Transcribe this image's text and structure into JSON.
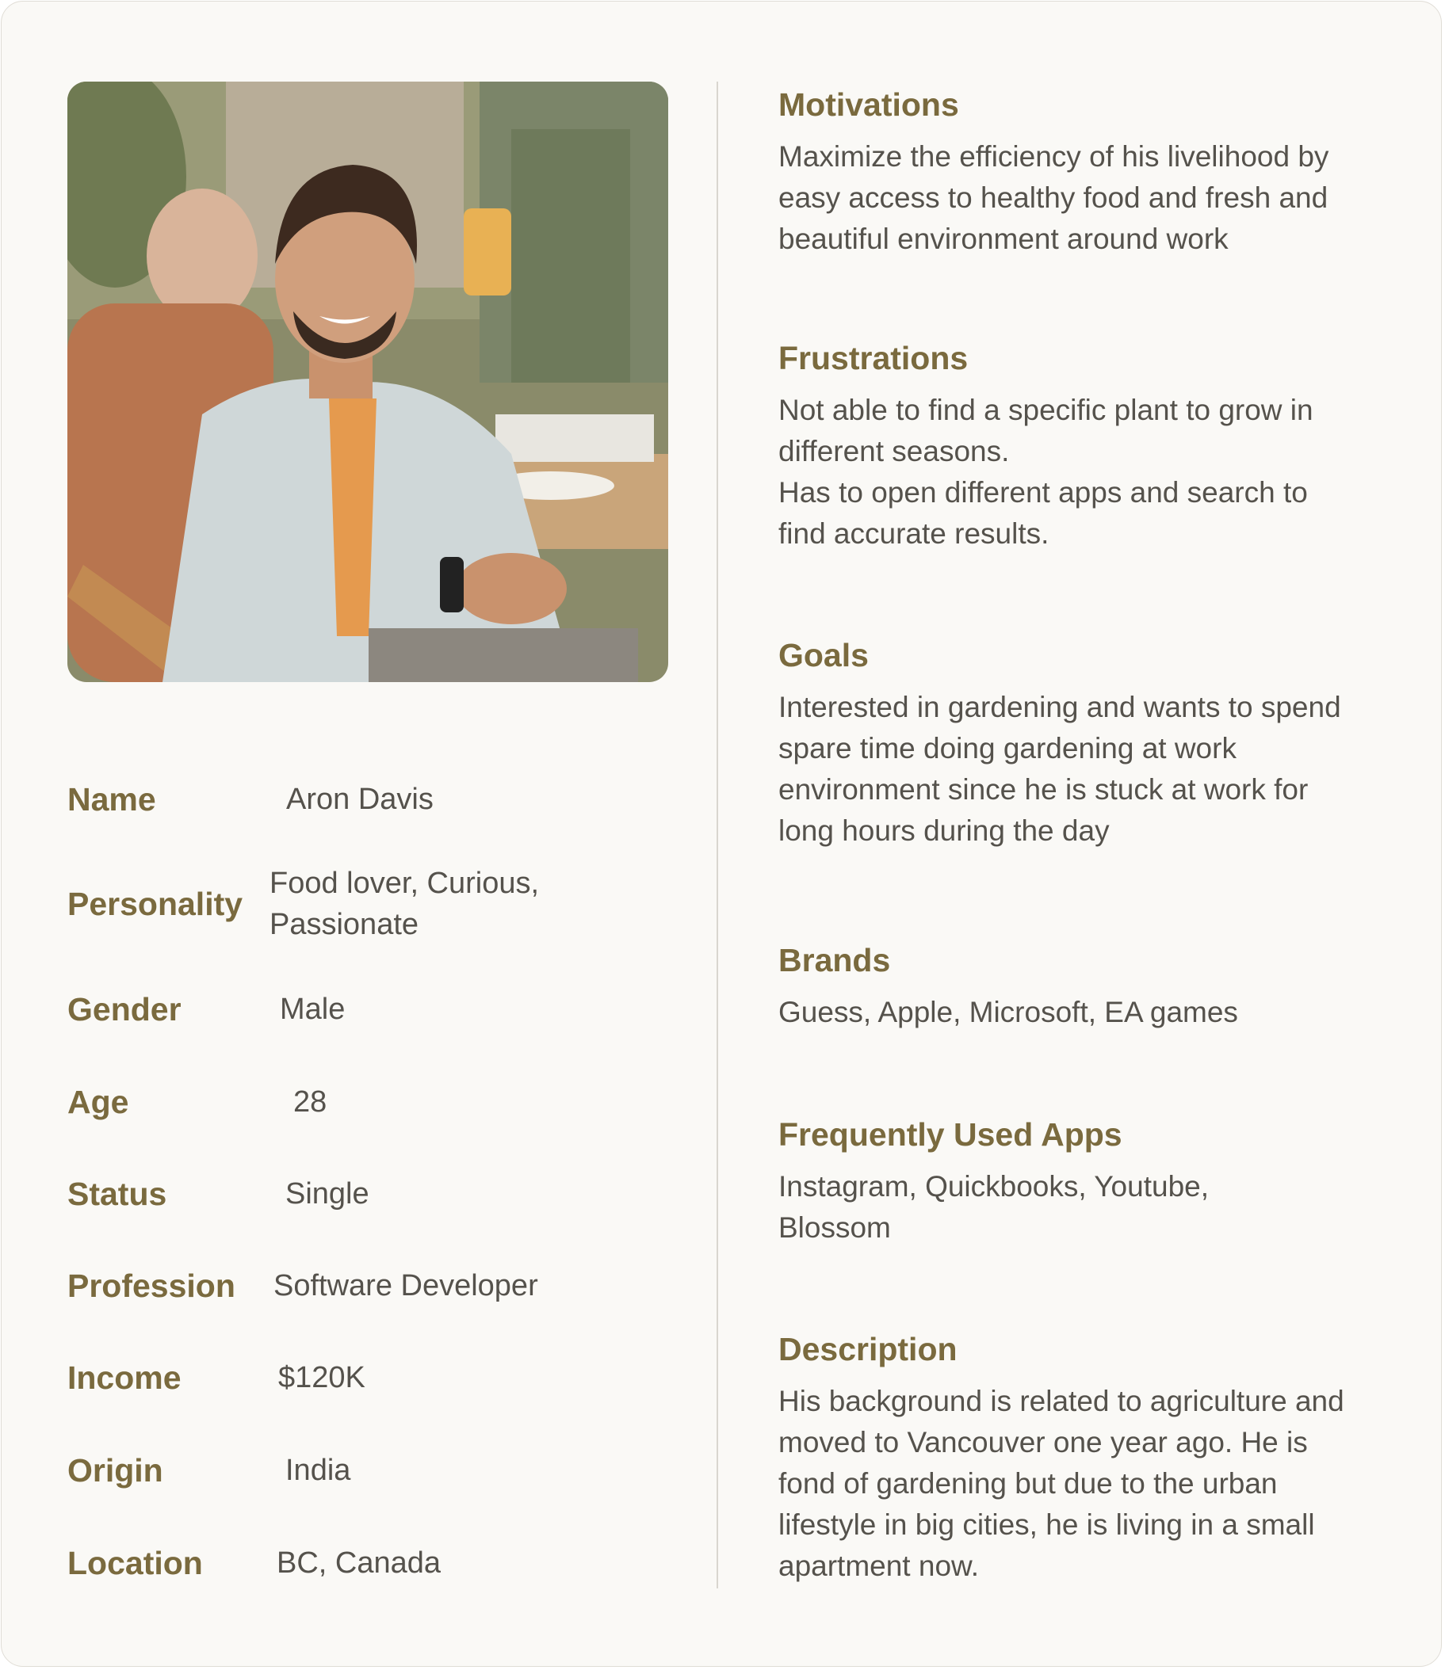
{
  "persona": {
    "photo_alt": "smiling-man-portrait",
    "attributes": [
      {
        "label": "Name",
        "value": "Aron Davis"
      },
      {
        "label": "Personality",
        "value_lines": [
          "Food lover, Curious,",
          "Passionate"
        ]
      },
      {
        "label": "Gender",
        "value": "Male"
      },
      {
        "label": "Age",
        "value": "28"
      },
      {
        "label": "Status",
        "value": "Single"
      },
      {
        "label": "Profession",
        "value": "Software Developer"
      },
      {
        "label": "Income",
        "value": "$120K"
      },
      {
        "label": "Origin",
        "value": "India"
      },
      {
        "label": "Location",
        "value": "BC, Canada"
      }
    ],
    "sections": {
      "motivations": {
        "title": "Motivations",
        "lines": [
          "Maximize the efficiency of his livelihood by",
          "easy access to healthy food and fresh and",
          "beautiful environment around work"
        ]
      },
      "frustrations": {
        "title": "Frustrations",
        "lines": [
          "Not able to find a specific plant to grow in",
          "different seasons.",
          "Has to open different apps and search to",
          "find accurate results."
        ]
      },
      "goals": {
        "title": "Goals",
        "lines": [
          "Interested in gardening and wants to spend",
          "spare time doing gardening at work",
          "environment since he is stuck at work for",
          "long hours during the day"
        ]
      },
      "brands": {
        "title": "Brands",
        "lines": [
          "Guess, Apple, Microsoft, EA games"
        ]
      },
      "apps": {
        "title": "Frequently Used Apps",
        "lines": [
          "Instagram, Quickbooks, Youtube,",
          "Blossom"
        ]
      },
      "description": {
        "title": "Description",
        "lines": [
          "His background is related to agriculture and",
          "moved to Vancouver one year ago. He is",
          "fond of gardening but due to the urban",
          "lifestyle in big cities, he is living in a small",
          "apartment now."
        ]
      }
    }
  },
  "colors": {
    "accent": "#7a6a3e",
    "text": "#55524c",
    "background": "#faf9f6",
    "divider": "#d9d6cf"
  }
}
